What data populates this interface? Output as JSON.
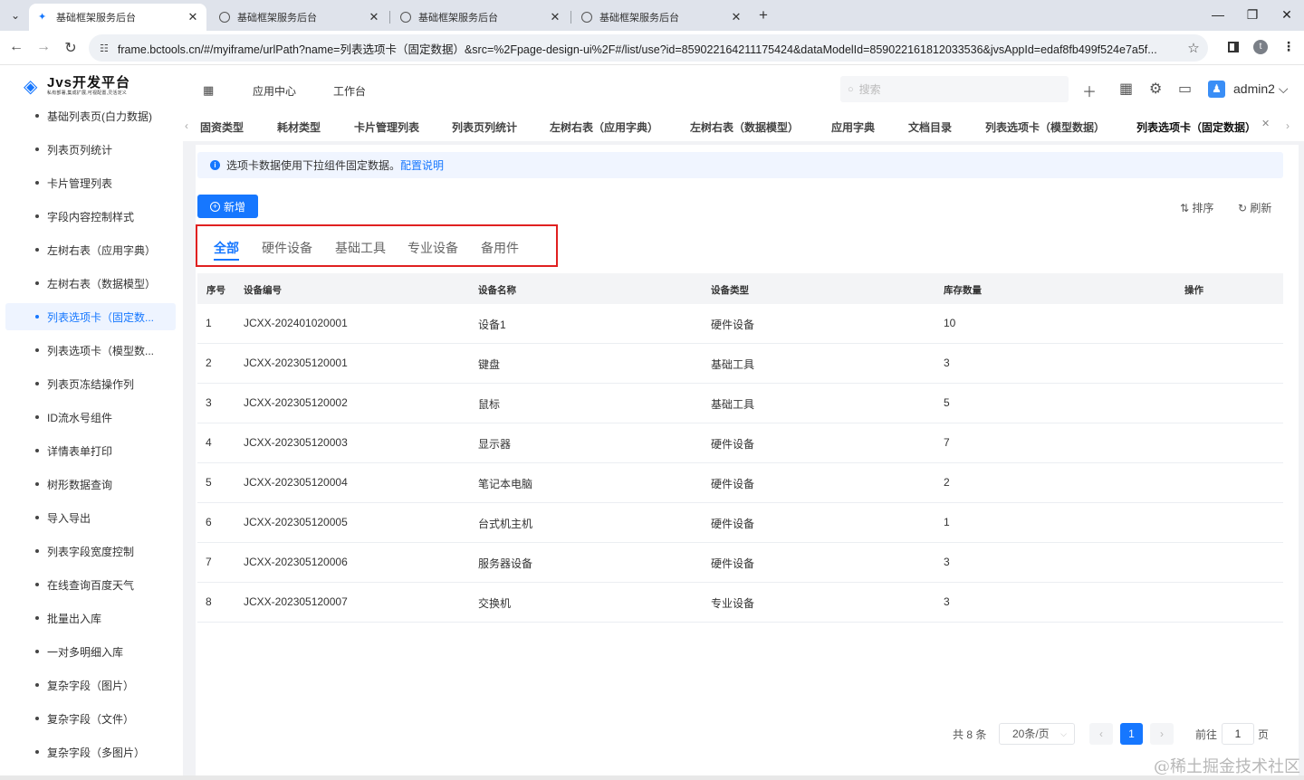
{
  "browser": {
    "tabs": [
      {
        "title": "基础框架服务后台",
        "active": true
      },
      {
        "title": "基础框架服务后台",
        "active": false
      },
      {
        "title": "基础框架服务后台",
        "active": false
      },
      {
        "title": "基础框架服务后台",
        "active": false
      }
    ],
    "new_tab": "+",
    "url": "frame.bctools.cn/#/myiframe/urlPath?name=列表选项卡（固定数据）&src=%2Fpage-design-ui%2F#/list/use?id=859022164211175424&dataModelId=859022161812033536&jvsAppId=edaf8fb499f524e7a5f...",
    "profile_initial": "t"
  },
  "app": {
    "logo_title": "Jvs开发平台",
    "logo_subtitle": "私有部署,集成扩展,可视配置,灵活定义",
    "nav": [
      "应用中心",
      "工作台"
    ],
    "search_placeholder": "搜索",
    "username": "admin2"
  },
  "sidebar": {
    "items": [
      {
        "label": "基础列表页(白力数据)",
        "active": false
      },
      {
        "label": "列表页列统计",
        "active": false
      },
      {
        "label": "卡片管理列表",
        "active": false
      },
      {
        "label": "字段内容控制样式",
        "active": false
      },
      {
        "label": "左树右表（应用字典）",
        "active": false
      },
      {
        "label": "左树右表（数据模型）",
        "active": false
      },
      {
        "label": "列表选项卡（固定数...",
        "active": true
      },
      {
        "label": "列表选项卡（模型数...",
        "active": false
      },
      {
        "label": "列表页冻结操作列",
        "active": false
      },
      {
        "label": "ID流水号组件",
        "active": false
      },
      {
        "label": "详情表单打印",
        "active": false
      },
      {
        "label": "树形数据查询",
        "active": false
      },
      {
        "label": "导入导出",
        "active": false
      },
      {
        "label": "列表字段宽度控制",
        "active": false
      },
      {
        "label": "在线查询百度天气",
        "active": false
      },
      {
        "label": "批量出入库",
        "active": false
      },
      {
        "label": "一对多明细入库",
        "active": false
      },
      {
        "label": "复杂字段（图片）",
        "active": false
      },
      {
        "label": "复杂字段（文件）",
        "active": false
      },
      {
        "label": "复杂字段（多图片）",
        "active": false
      }
    ]
  },
  "page_tabs": [
    "固资类型",
    "耗材类型",
    "卡片管理列表",
    "列表页列统计",
    "左树右表（应用字典）",
    "左树右表（数据模型）",
    "应用字典",
    "文档目录",
    "列表选项卡（模型数据）",
    "列表选项卡（固定数据）"
  ],
  "notice": {
    "text": "选项卡数据使用下拉组件固定数据。",
    "link": "配置说明"
  },
  "toolbar": {
    "add": "新增",
    "sort": "排序",
    "refresh": "刷新"
  },
  "filter_tabs": [
    "全部",
    "硬件设备",
    "基础工具",
    "专业设备",
    "备用件"
  ],
  "table": {
    "columns": [
      "序号",
      "设备编号",
      "设备名称",
      "设备类型",
      "库存数量",
      "操作"
    ],
    "rows": [
      [
        "1",
        "JCXX-202401020001",
        "设备1",
        "硬件设备",
        "10"
      ],
      [
        "2",
        "JCXX-202305120001",
        "键盘",
        "基础工具",
        "3"
      ],
      [
        "3",
        "JCXX-202305120002",
        "鼠标",
        "基础工具",
        "5"
      ],
      [
        "4",
        "JCXX-202305120003",
        "显示器",
        "硬件设备",
        "7"
      ],
      [
        "5",
        "JCXX-202305120004",
        "笔记本电脑",
        "硬件设备",
        "2"
      ],
      [
        "6",
        "JCXX-202305120005",
        "台式机主机",
        "硬件设备",
        "1"
      ],
      [
        "7",
        "JCXX-202305120006",
        "服务器设备",
        "硬件设备",
        "3"
      ],
      [
        "8",
        "JCXX-202305120007",
        "交换机",
        "专业设备",
        "3"
      ]
    ]
  },
  "pagination": {
    "total": "共 8 条",
    "page_size": "20条/页",
    "current_page": "1",
    "goto_label": "前往",
    "goto_value": "1",
    "page_unit": "页"
  },
  "watermark": "@稀土掘金技术社区"
}
